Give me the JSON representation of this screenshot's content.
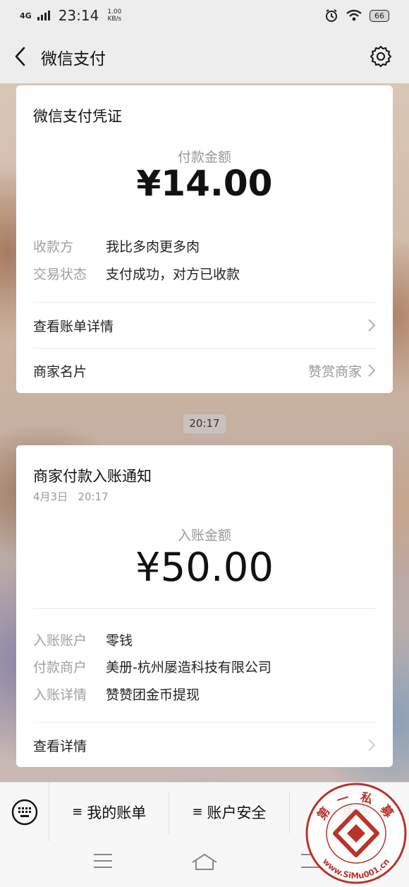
{
  "status_bar": {
    "network": "4G",
    "time": "23:14",
    "speed_value": "1.00",
    "speed_unit": "KB/s",
    "battery": "66"
  },
  "nav": {
    "title": "微信支付"
  },
  "receipt": {
    "heading": "微信支付凭证",
    "amount_label": "付款金额",
    "amount": "¥14.00",
    "rows": [
      {
        "key": "收款方",
        "value": "我比多肉更多肉"
      },
      {
        "key": "交易状态",
        "value": "支付成功，对方已收款"
      }
    ],
    "bill_details_link": "查看账单详情",
    "merchant_card_label": "商家名片",
    "merchant_card_action": "赞赏商家"
  },
  "timestamp": "20:17",
  "deposit": {
    "heading": "商家付款入账通知",
    "date": "4月3日",
    "time": "20:17",
    "amount_label": "入账金额",
    "amount": "¥50.00",
    "rows": [
      {
        "key": "入账账户",
        "value": "零钱"
      },
      {
        "key": "付款商户",
        "value": "美册-杭州屡造科技有限公司"
      },
      {
        "key": "入账详情",
        "value": "赞赞团金币提现"
      }
    ],
    "details_link": "查看详情"
  },
  "menu": {
    "items": [
      {
        "label": "我的账单"
      },
      {
        "label": "账户安全"
      },
      {
        "label": "更多"
      }
    ]
  },
  "watermark": {
    "text_top": "第 一 私 募",
    "text_bottom": "www.SiMu001.cn"
  }
}
